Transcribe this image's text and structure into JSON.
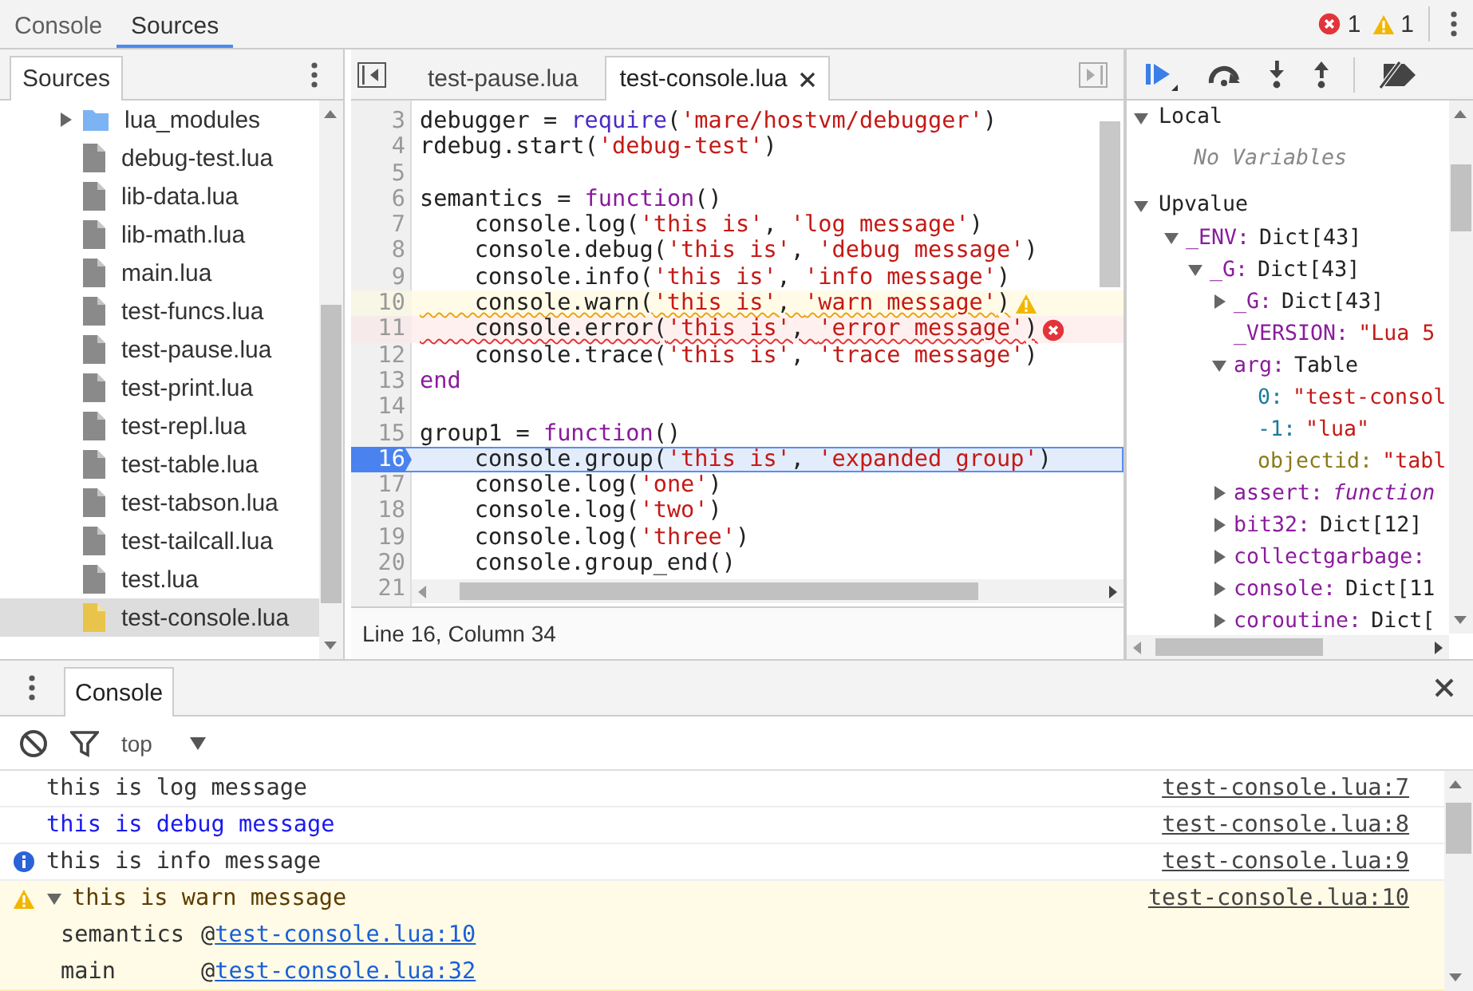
{
  "top_bar": {
    "tabs": [
      {
        "label": "Console",
        "selected": false
      },
      {
        "label": "Sources",
        "selected": true
      }
    ],
    "error_count": "1",
    "warning_count": "1"
  },
  "navigator": {
    "tab": "Sources",
    "items": [
      {
        "kind": "folder",
        "label": "lua_modules",
        "expanded": false,
        "selected": false
      },
      {
        "kind": "file",
        "label": "debug-test.lua",
        "selected": false
      },
      {
        "kind": "file",
        "label": "lib-data.lua",
        "selected": false
      },
      {
        "kind": "file",
        "label": "lib-math.lua",
        "selected": false
      },
      {
        "kind": "file",
        "label": "main.lua",
        "selected": false
      },
      {
        "kind": "file",
        "label": "test-funcs.lua",
        "selected": false
      },
      {
        "kind": "file",
        "label": "test-pause.lua",
        "selected": false
      },
      {
        "kind": "file",
        "label": "test-print.lua",
        "selected": false
      },
      {
        "kind": "file",
        "label": "test-repl.lua",
        "selected": false
      },
      {
        "kind": "file",
        "label": "test-table.lua",
        "selected": false
      },
      {
        "kind": "file",
        "label": "test-tabson.lua",
        "selected": false
      },
      {
        "kind": "file",
        "label": "test-tailcall.lua",
        "selected": false
      },
      {
        "kind": "file",
        "label": "test.lua",
        "selected": false
      },
      {
        "kind": "file",
        "label": "test-console.lua",
        "selected": true
      }
    ]
  },
  "editor": {
    "tabs": [
      {
        "label": "test-pause.lua",
        "selected": false,
        "closable": false
      },
      {
        "label": "test-console.lua",
        "selected": true,
        "closable": true
      }
    ],
    "lines": [
      {
        "number": "3",
        "kind": "normal",
        "code": [
          {
            "kind": "plain",
            "text": "debugger = "
          },
          {
            "kind": "builtin",
            "text": "require"
          },
          {
            "kind": "plain",
            "text": "("
          },
          {
            "kind": "string",
            "text": "'mare/hostvm/debugger'"
          },
          {
            "kind": "plain",
            "text": ")"
          }
        ]
      },
      {
        "number": "4",
        "kind": "normal",
        "code": [
          {
            "kind": "plain",
            "text": "rdebug.start("
          },
          {
            "kind": "string",
            "text": "'debug-test'"
          },
          {
            "kind": "plain",
            "text": ")"
          }
        ]
      },
      {
        "number": "5",
        "kind": "normal"
      },
      {
        "number": "6",
        "kind": "normal",
        "code": [
          {
            "kind": "plain",
            "text": "semantics = "
          },
          {
            "kind": "keyword",
            "text": "function"
          },
          {
            "kind": "plain",
            "text": "()"
          }
        ]
      },
      {
        "number": "7",
        "kind": "normal",
        "code": [
          {
            "kind": "plain",
            "text": "    console.log("
          },
          {
            "kind": "string",
            "text": "'this is'"
          },
          {
            "kind": "plain",
            "text": ", "
          },
          {
            "kind": "string",
            "text": "'log message'"
          },
          {
            "kind": "plain",
            "text": ")"
          }
        ]
      },
      {
        "number": "8",
        "kind": "normal",
        "code": [
          {
            "kind": "plain",
            "text": "    console.debug("
          },
          {
            "kind": "string",
            "text": "'this is'"
          },
          {
            "kind": "plain",
            "text": ", "
          },
          {
            "kind": "string",
            "text": "'debug message'"
          },
          {
            "kind": "plain",
            "text": ")"
          }
        ]
      },
      {
        "number": "9",
        "kind": "normal",
        "code": [
          {
            "kind": "plain",
            "text": "    console.info("
          },
          {
            "kind": "string",
            "text": "'this is'"
          },
          {
            "kind": "plain",
            "text": ", "
          },
          {
            "kind": "string",
            "text": "'info message'"
          },
          {
            "kind": "plain",
            "text": ")"
          }
        ]
      },
      {
        "number": "10",
        "kind": "warning",
        "code": [
          {
            "kind": "plain",
            "text": "    console.warn("
          },
          {
            "kind": "string",
            "text": "'this is'"
          },
          {
            "kind": "plain",
            "text": ", "
          },
          {
            "kind": "string",
            "text": "'warn message'"
          },
          {
            "kind": "plain",
            "text": ")"
          }
        ]
      },
      {
        "number": "11",
        "kind": "error",
        "code": [
          {
            "kind": "plain",
            "text": "    console.error("
          },
          {
            "kind": "string",
            "text": "'this is'"
          },
          {
            "kind": "plain",
            "text": ", "
          },
          {
            "kind": "string",
            "text": "'error message'"
          },
          {
            "kind": "plain",
            "text": ")"
          }
        ]
      },
      {
        "number": "12",
        "kind": "normal",
        "code": [
          {
            "kind": "plain",
            "text": "    console.trace("
          },
          {
            "kind": "string",
            "text": "'this is'"
          },
          {
            "kind": "plain",
            "text": ", "
          },
          {
            "kind": "string",
            "text": "'trace message'"
          },
          {
            "kind": "plain",
            "text": ")"
          }
        ]
      },
      {
        "number": "13",
        "kind": "normal",
        "code": [
          {
            "kind": "keyword",
            "text": "end"
          }
        ]
      },
      {
        "number": "14",
        "kind": "normal"
      },
      {
        "number": "15",
        "kind": "normal",
        "code": [
          {
            "kind": "plain",
            "text": "group1 = "
          },
          {
            "kind": "keyword",
            "text": "function"
          },
          {
            "kind": "plain",
            "text": "()"
          }
        ]
      },
      {
        "number": "16",
        "kind": "paused",
        "code": [
          {
            "kind": "plain",
            "text": "    console.group("
          },
          {
            "kind": "string",
            "text": "'this is'"
          },
          {
            "kind": "plain",
            "text": ", "
          },
          {
            "kind": "string",
            "text": "'expanded group'"
          },
          {
            "kind": "plain",
            "text": ")"
          }
        ]
      },
      {
        "number": "17",
        "kind": "normal",
        "code": [
          {
            "kind": "plain",
            "text": "    console.log("
          },
          {
            "kind": "string",
            "text": "'one'"
          },
          {
            "kind": "plain",
            "text": ")"
          }
        ]
      },
      {
        "number": "18",
        "kind": "normal",
        "code": [
          {
            "kind": "plain",
            "text": "    console.log("
          },
          {
            "kind": "string",
            "text": "'two'"
          },
          {
            "kind": "plain",
            "text": ")"
          }
        ]
      },
      {
        "number": "19",
        "kind": "normal",
        "code": [
          {
            "kind": "plain",
            "text": "    console.log("
          },
          {
            "kind": "string",
            "text": "'three'"
          },
          {
            "kind": "plain",
            "text": ")"
          }
        ]
      },
      {
        "number": "20",
        "kind": "normal",
        "code": [
          {
            "kind": "plain",
            "text": "    console.group_end()"
          }
        ]
      },
      {
        "number": "21",
        "kind": "normal"
      }
    ],
    "status": "Line 16, Column 34"
  },
  "scope": {
    "sections": [
      {
        "title": "Local",
        "expanded": true,
        "empty_text": "No Variables"
      },
      {
        "title": "Upvalue",
        "expanded": true,
        "items": [
          {
            "name": {
              "kind": "property",
              "text": "_ENV:"
            },
            "value": {
              "kind": "object",
              "text": "Dict[43]"
            },
            "expanded": true,
            "children": [
              {
                "name": {
                  "kind": "property",
                  "text": "_G:"
                },
                "value": {
                  "kind": "object",
                  "text": "Dict[43]"
                },
                "expanded": true,
                "children": [
                  {
                    "name": {
                      "kind": "property",
                      "text": "_G:"
                    },
                    "value": {
                      "kind": "object",
                      "text": "Dict[43]"
                    },
                    "expanded": false
                  },
                  {
                    "name": {
                      "kind": "property",
                      "text": "_VERSION:"
                    },
                    "value": {
                      "kind": "string",
                      "text": "\"Lua 5"
                    }
                  },
                  {
                    "name": {
                      "kind": "property",
                      "text": "arg:"
                    },
                    "value": {
                      "kind": "object",
                      "text": "Table"
                    },
                    "expanded": true,
                    "children": [
                      {
                        "name": {
                          "kind": "index",
                          "text": "0:"
                        },
                        "value": {
                          "kind": "string",
                          "text": "\"test-consol"
                        }
                      },
                      {
                        "name": {
                          "kind": "index",
                          "text": "-1:"
                        },
                        "value": {
                          "kind": "string",
                          "text": "\"lua\""
                        }
                      },
                      {
                        "name": {
                          "kind": "meta",
                          "text": "objectid:"
                        },
                        "value": {
                          "kind": "string",
                          "text": "\"tabl"
                        }
                      }
                    ]
                  },
                  {
                    "name": {
                      "kind": "property",
                      "text": "assert:"
                    },
                    "value": {
                      "kind": "function",
                      "text": "function"
                    },
                    "expanded": false
                  },
                  {
                    "name": {
                      "kind": "property",
                      "text": "bit32:"
                    },
                    "value": {
                      "kind": "object",
                      "text": "Dict[12]"
                    },
                    "expanded": false
                  },
                  {
                    "name": {
                      "kind": "property",
                      "text": "collectgarbage:"
                    },
                    "expanded": false
                  },
                  {
                    "name": {
                      "kind": "property",
                      "text": "console:"
                    },
                    "value": {
                      "kind": "object",
                      "text": "Dict[11"
                    },
                    "expanded": false
                  },
                  {
                    "name": {
                      "kind": "property",
                      "text": "coroutine:"
                    },
                    "value": {
                      "kind": "object",
                      "text": "Dict["
                    },
                    "expanded": false
                  }
                ]
              }
            ]
          }
        ]
      }
    ]
  },
  "console": {
    "tab": "Console",
    "tab_selected": true,
    "context": "top",
    "messages": [
      {
        "kind": "log",
        "text": "this is log message",
        "source": "test-console.lua:7"
      },
      {
        "kind": "debug",
        "text": "this is debug message",
        "source": "test-console.lua:8"
      },
      {
        "kind": "info",
        "text": "this is info message",
        "source": "test-console.lua:9"
      },
      {
        "kind": "warn",
        "text": "this is warn message",
        "source": "test-console.lua:10",
        "expanded": true,
        "stack": [
          {
            "function": "semantics",
            "at": "@",
            "link": "test-console.lua:10"
          },
          {
            "function": "main",
            "at": "@",
            "link": "test-console.lua:32"
          }
        ]
      }
    ]
  }
}
